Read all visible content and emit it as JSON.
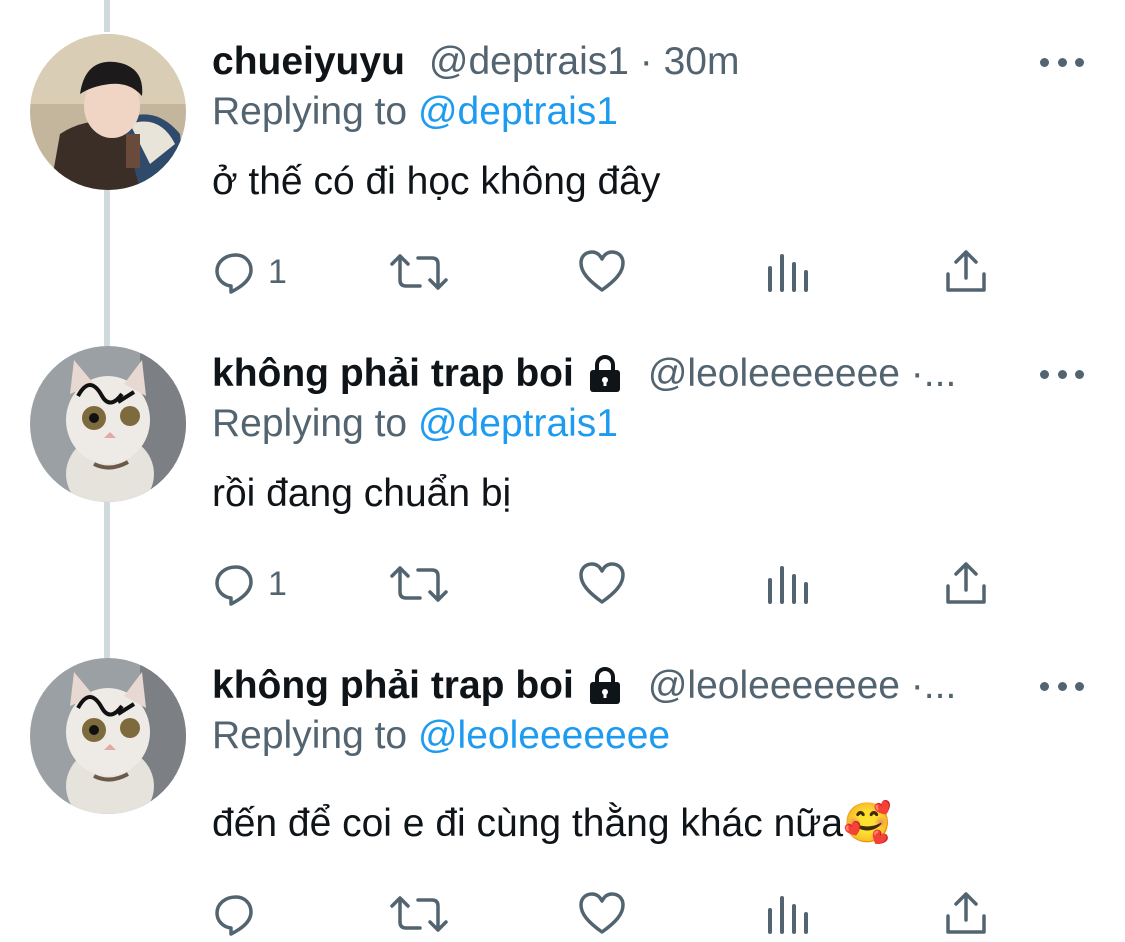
{
  "replying_prefix": "Replying to",
  "tweets": [
    {
      "name": "chueiyuyu",
      "handle": "@deptrais1 · 30m",
      "replying_to": "@deptrais1",
      "text": "ở thế có đi học không đây",
      "reply_count": "1",
      "locked": false
    },
    {
      "name": "không phải trap boi",
      "handle": "@leoleeeeeee ·...",
      "replying_to": "@deptrais1",
      "text": "rồi đang chuẩn bị",
      "reply_count": "1",
      "locked": true
    },
    {
      "name": "không phải trap boi",
      "handle": "@leoleeeeeee ·...",
      "replying_to": "@leoleeeeeee",
      "text": "đến để coi e đi cùng thằng khác nữa🥰",
      "reply_count": "",
      "locked": true
    }
  ],
  "icons": {
    "reply": "reply-icon",
    "retweet": "retweet-icon",
    "like": "heart-icon",
    "views": "analytics-icon",
    "share": "share-icon",
    "more": "more-icon",
    "lock": "lock-icon"
  },
  "colors": {
    "text": "#0f1419",
    "secondary": "#536471",
    "link": "#1d9bf0",
    "thread_line": "#cfd9de"
  }
}
